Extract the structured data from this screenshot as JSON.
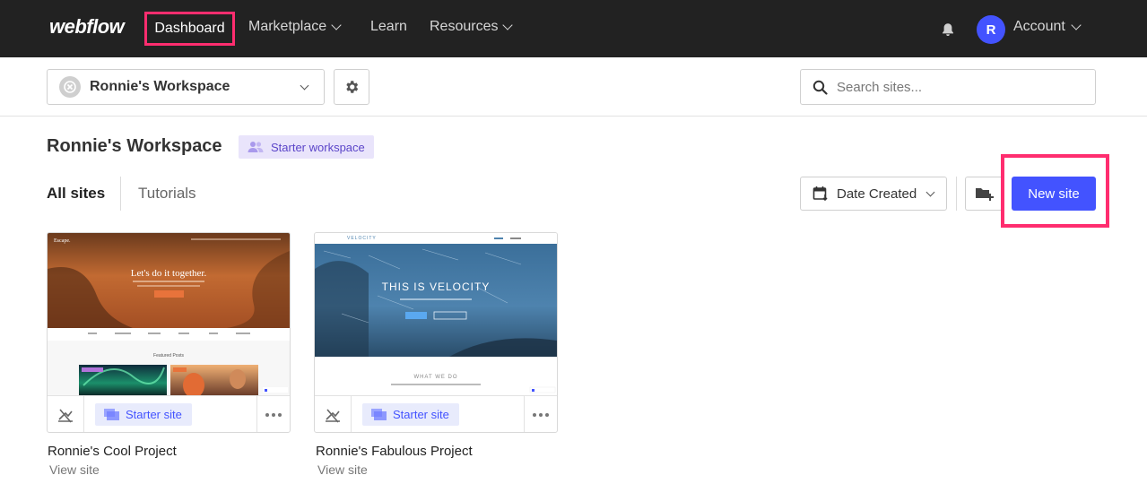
{
  "topnav": {
    "logo": "webflow",
    "dashboard": "Dashboard",
    "marketplace": "Marketplace",
    "learn": "Learn",
    "resources": "Resources",
    "avatar_initial": "R",
    "account": "Account"
  },
  "workspace_bar": {
    "selected_workspace": "Ronnie's Workspace",
    "search_placeholder": "Search sites..."
  },
  "header": {
    "title": "Ronnie's Workspace",
    "badge": "Starter workspace"
  },
  "tabs": {
    "all": "All sites",
    "tutorials": "Tutorials"
  },
  "toolbar": {
    "sort_label": "Date Created",
    "new_site": "New site"
  },
  "sites": [
    {
      "name": "Ronnie's Cool Project",
      "view": "View site",
      "plan": "Starter site",
      "thumb": {
        "brand": "Escape.",
        "headline": "Let's do it together.",
        "section": "Featured Posts"
      }
    },
    {
      "name": "Ronnie's Fabulous Project",
      "view": "View site",
      "plan": "Starter site",
      "thumb": {
        "brand": "VELOCITY",
        "headline": "THIS IS VELOCITY",
        "section": "WHAT WE DO"
      }
    }
  ],
  "colors": {
    "nav_bg": "#222222",
    "accent": "#4353ff",
    "highlight": "#ff2d6f"
  }
}
